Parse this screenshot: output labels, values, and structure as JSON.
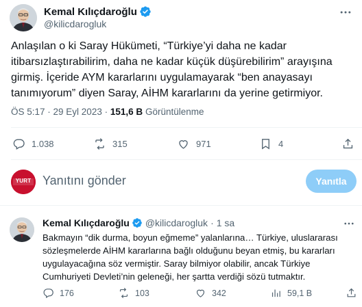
{
  "main_tweet": {
    "author_name": "Kemal Kılıçdaroğlu",
    "handle": "@kilicdarogluk",
    "text": "Anlaşılan o ki Saray Hükümeti, “Türkiye’yi daha ne kadar itibarsızlaştırabilirim, daha ne kadar küçük düşürebilirim” arayışına girmiş. İçeride AYM kararlarını uygulamayarak “ben anayasayı tanımıyorum” diyen Saray, AİHM kararlarını da yerine getirmiyor.",
    "timestamp": "ÖS 5:17 · 29 Eyl 2023",
    "meta_separator": "·",
    "views_count": "151,6 B",
    "views_label": "Görüntülenme",
    "actions": {
      "replies": "1.038",
      "retweets": "315",
      "likes": "971",
      "bookmarks": "4"
    }
  },
  "composer": {
    "placeholder": "Yanıtını gönder",
    "button_label": "Yanıtla",
    "avatar_brand": "YURT"
  },
  "reply_tweet": {
    "author_name": "Kemal Kılıçdaroğlu",
    "handle": "@kilicdarogluk",
    "separator": "·",
    "time_ago": "1 sa",
    "text": "Bakmayın “dik durma, boyun eğmeme” yalanlarına… Türkiye, uluslararası sözleşmelerde AİHM kararlarına bağlı olduğunu beyan etmiş, bu kararları uygulayacağına söz vermiştir. Saray bilmiyor olabilir, ancak Türkiye Cumhuriyeti Devleti’nin geleneği, her şartta verdiği sözü tutmaktır.",
    "actions": {
      "replies": "176",
      "retweets": "103",
      "likes": "342",
      "views": "59,1 B"
    }
  },
  "colors": {
    "verified": "#1d9bf0",
    "secondary_text": "#536471",
    "reply_button": "#8ecdf8",
    "brand_red": "#c8102e"
  },
  "icons": [
    "verified-badge-icon",
    "more-icon",
    "reply-icon",
    "retweet-icon",
    "like-icon",
    "bookmark-icon",
    "share-icon",
    "views-icon"
  ]
}
